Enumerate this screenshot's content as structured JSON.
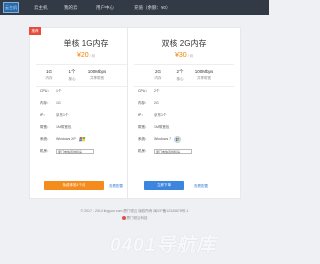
{
  "header": {
    "logo_text": "云主机",
    "nav": [
      "云主机",
      "我的云",
      "用户中心",
      "充值（余额：¥0）"
    ]
  },
  "cards": [
    {
      "ribbon": "推荐",
      "title": "单核 1G内存",
      "price": "¥20",
      "price_unit": "/ 月",
      "specs": [
        {
          "value": "1G",
          "label": "内存"
        },
        {
          "value": "1个",
          "label": "核心"
        },
        {
          "value": "100Mbps",
          "label": "共享带宽"
        }
      ],
      "rows": [
        {
          "label": "CPU：",
          "value": "1个"
        },
        {
          "label": "内存：",
          "value": "1G"
        },
        {
          "label": "IP：",
          "value": "京东1个"
        },
        {
          "label": "带宽：",
          "value": "1M带宽包"
        },
        {
          "label": "系统：",
          "value": "Windows XP"
        },
        {
          "label": "机房：",
          "value": "厦门电信双线机房"
        }
      ],
      "button": "免费体验1个月",
      "link": "查看配置",
      "button_color": "#f38b1d",
      "os_icon": "windows-xp-logo-icon"
    },
    {
      "ribbon": "",
      "title": "双核 2G内存",
      "price": "¥30",
      "price_unit": "/ 月",
      "specs": [
        {
          "value": "2G",
          "label": "内存"
        },
        {
          "value": "2个",
          "label": "核心"
        },
        {
          "value": "100Mbps",
          "label": "共享带宽"
        }
      ],
      "rows": [
        {
          "label": "CPU：",
          "value": "2个"
        },
        {
          "label": "内存：",
          "value": "2G"
        },
        {
          "label": "IP：",
          "value": "京东1个"
        },
        {
          "label": "带宽：",
          "value": "1M带宽包"
        },
        {
          "label": "系统：",
          "value": "Windows 7"
        },
        {
          "label": "机房：",
          "value": "厦门电信双线机房"
        }
      ],
      "button": "立即下单",
      "link": "查看配置",
      "button_color": "#3d86e0",
      "os_icon": "windows-7-logo-icon"
    }
  ],
  "footer": {
    "line1": "© 2017 - 2014 lingyun.com 厦门领云 版权所有 闽ICP备12345678号-1",
    "line2": "厦门领云科技"
  },
  "watermark": "0401导航库"
}
